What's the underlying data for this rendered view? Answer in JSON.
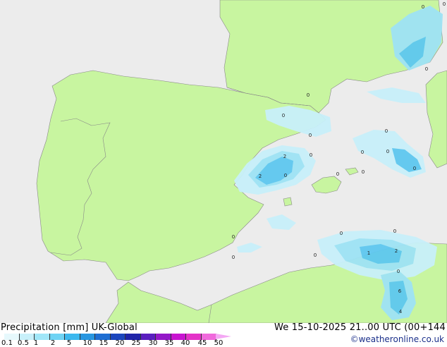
{
  "map": {
    "region": "Iberian Peninsula and western Mediterranean",
    "colors": {
      "sea": "#ececec",
      "land": "#c8f5a0",
      "border": "#888888",
      "precip_light": "#c8f0fa",
      "precip_mid": "#9ee3f5",
      "precip_heavy": "#5ec8f0",
      "precip_strong": "#3aa6e6"
    },
    "max_markers": [
      "0",
      "0",
      "0",
      "0",
      "0",
      "0",
      "0",
      "0",
      "2",
      "0",
      "2",
      "0",
      "0",
      "0",
      "0",
      "0",
      "0",
      "0",
      "0",
      "0",
      "1",
      "2",
      "0",
      "6",
      "4",
      "0"
    ]
  },
  "footer": {
    "title": "Precipitation [mm] UK-Global",
    "datetime": "We 15-10-2025 21..00 UTC (00+144",
    "credit": "©weatheronline.co.uk",
    "scale_values": [
      "0.1",
      "0.5",
      "1",
      "2",
      "5",
      "10",
      "15",
      "20",
      "25",
      "30",
      "35",
      "40",
      "45",
      "50"
    ],
    "scale_colors": [
      "#e6f8fc",
      "#c8f0fa",
      "#a0e6f8",
      "#6fd3f4",
      "#3cb8ee",
      "#2896e0",
      "#1f6ed2",
      "#1c46bd",
      "#2024a8",
      "#5a1ebf",
      "#9418c8",
      "#c814d0",
      "#e432c8",
      "#f06adc"
    ]
  }
}
